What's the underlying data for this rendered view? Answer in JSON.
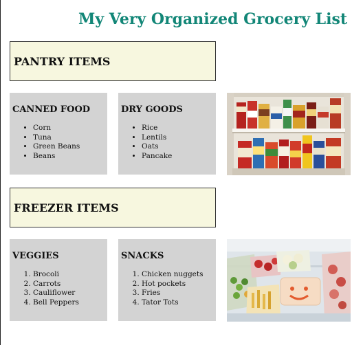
{
  "title": "My Very Organized Grocery List",
  "sections": [
    {
      "header": "PANTRY ITEMS",
      "lists": [
        {
          "title": "CANNED FOOD",
          "style": "bullet",
          "items": [
            "Corn",
            "Tuna",
            "Green Beans",
            "Beans"
          ]
        },
        {
          "title": "DRY GOODS",
          "style": "bullet",
          "items": [
            "Rice",
            "Lentils",
            "Oats",
            "Pancake"
          ]
        }
      ],
      "image": "pantry-shelves-photo"
    },
    {
      "header": "FREEZER ITEMS",
      "lists": [
        {
          "title": "VEGGIES",
          "style": "numbered",
          "items": [
            "Brocoli",
            "Carrots",
            "Cauliflower",
            "Bell Peppers"
          ]
        },
        {
          "title": "SNACKS",
          "style": "numbered",
          "items": [
            "Chicken nuggets",
            "Hot pockets",
            "Fries",
            "Tator Tots"
          ]
        }
      ],
      "image": "freezer-bags-photo"
    }
  ],
  "colors": {
    "title": "#128677",
    "header_bg": "#f7f7df",
    "card_bg": "#d3d3d3"
  }
}
